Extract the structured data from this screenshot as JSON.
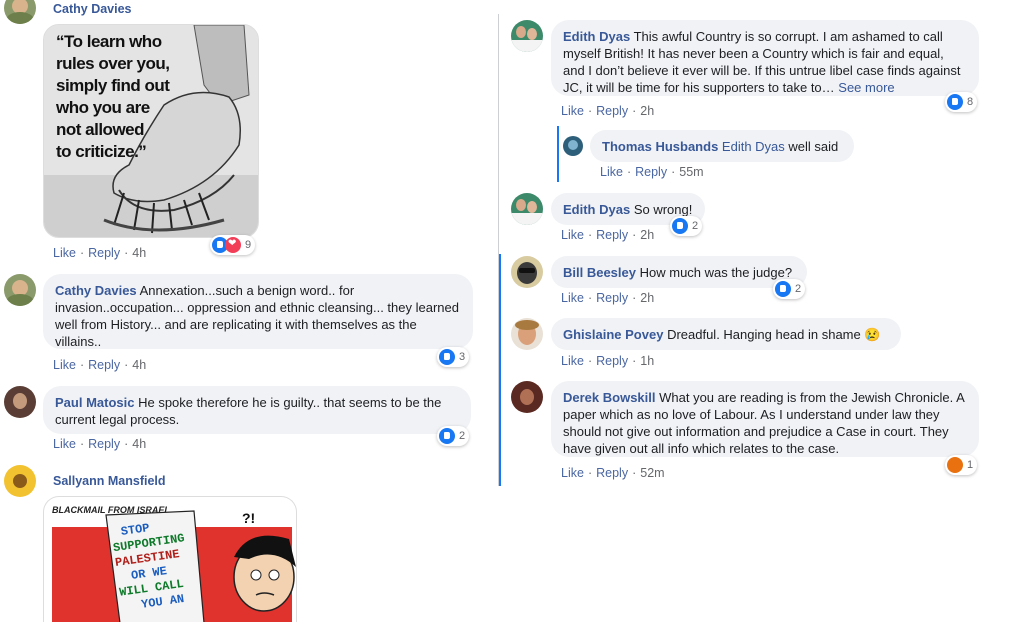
{
  "actions": {
    "like": "Like",
    "reply": "Reply",
    "sep": "·",
    "see_more": "See more"
  },
  "left": {
    "c1": {
      "author": "Cathy Davies",
      "quote_lines": [
        "“To learn who",
        "rules over you,",
        "simply find out",
        "who you are",
        "not allowed",
        "to criticize.”"
      ],
      "time": "4h",
      "reactions": "9"
    },
    "c2": {
      "author": "Cathy Davies",
      "text": "Annexation...such a benign word.. for invasion..occupation... oppression and ethnic cleansing... they learned well from History... and are replicating it with themselves as the villains..",
      "time": "4h",
      "reactions": "3"
    },
    "c3": {
      "author": "Paul Matosic",
      "text": "He spoke therefore he is guilty.. that seems to be the current legal process.",
      "time": "4h",
      "reactions": "2"
    },
    "c4": {
      "author": "Sallyann Mansfield",
      "cartoon_caption": "BLACKMAIL FROM ISRAEL...",
      "cartoon_letters": [
        "STOP",
        "SUPPORTING",
        "PALESTINE",
        "OR WE",
        "WILL CALL",
        "YOU AN"
      ],
      "cartoon_symbol": "?!"
    }
  },
  "right": {
    "c1": {
      "author": "Edith Dyas",
      "text": "This awful Country is so corrupt. I am ashamed to call myself British! It has never been a Country which is fair and equal, and I don’t believe it ever will be. If this untrue libel case finds against JC, it will be time for his supporters to take to…",
      "time": "2h",
      "reactions": "8"
    },
    "c1r": {
      "author": "Thomas Husbands",
      "mention": "Edith Dyas",
      "text": "well said",
      "time": "55m"
    },
    "c2": {
      "author": "Edith Dyas",
      "text": "So wrong!",
      "time": "2h",
      "reactions": "2"
    },
    "c3": {
      "author": "Bill Beesley",
      "text": "How much was the judge?",
      "time": "2h",
      "reactions": "2"
    },
    "c4": {
      "author": "Ghislaine Povey",
      "text": "Dreadful. Hanging head in shame 😢",
      "time": "1h"
    },
    "c5": {
      "author": "Derek Bowskill",
      "text": "What you are reading is from the Jewish Chronicle. A paper which as no love of Labour. As I understand under law they should not give out information and prejudice a Case in court. They have given out all info which relates to the case.",
      "time": "52m",
      "reactions": "1"
    }
  },
  "colors": {
    "link": "#385898",
    "bubble": "#f0f2f5",
    "like": "#1877f2",
    "love": "#f33e58",
    "angry": "#e9710f"
  }
}
